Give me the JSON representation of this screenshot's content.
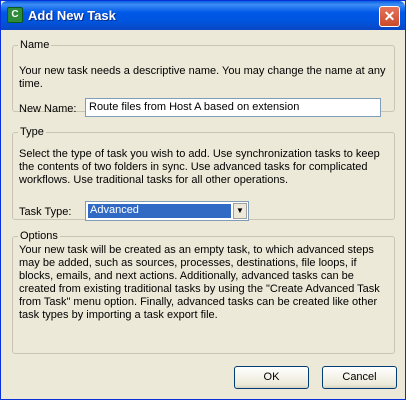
{
  "window": {
    "title": "Add New Task",
    "icon": "task-app-icon",
    "close_glyph": "✕"
  },
  "name_group": {
    "legend": "Name",
    "description": "Your new task needs a descriptive name.  You may change the name at any time.",
    "label": "New Name:",
    "value": "Route files from Host A based on extension"
  },
  "type_group": {
    "legend": "Type",
    "description": "Select the type of task you wish to add. Use synchronization tasks to keep the contents of two folders in sync. Use advanced tasks for complicated workflows. Use traditional tasks for all other operations.",
    "label": "Task Type:",
    "selected": "Advanced",
    "arrow": "▼"
  },
  "options_group": {
    "legend": "Options",
    "description": "Your new task will be created as an empty task, to which advanced steps may be added, such as sources, processes, destinations, file loops, if blocks, emails, and next actions. Additionally, advanced tasks can be created from existing traditional tasks by using the \"Create Advanced Task from Task\" menu option. Finally, advanced tasks can be created like other task types by importing a task export file."
  },
  "buttons": {
    "ok": "OK",
    "cancel": "Cancel"
  },
  "colors": {
    "titlebar": "#0058e7",
    "dialog_bg": "#ece9d8",
    "selection": "#316ac5"
  }
}
